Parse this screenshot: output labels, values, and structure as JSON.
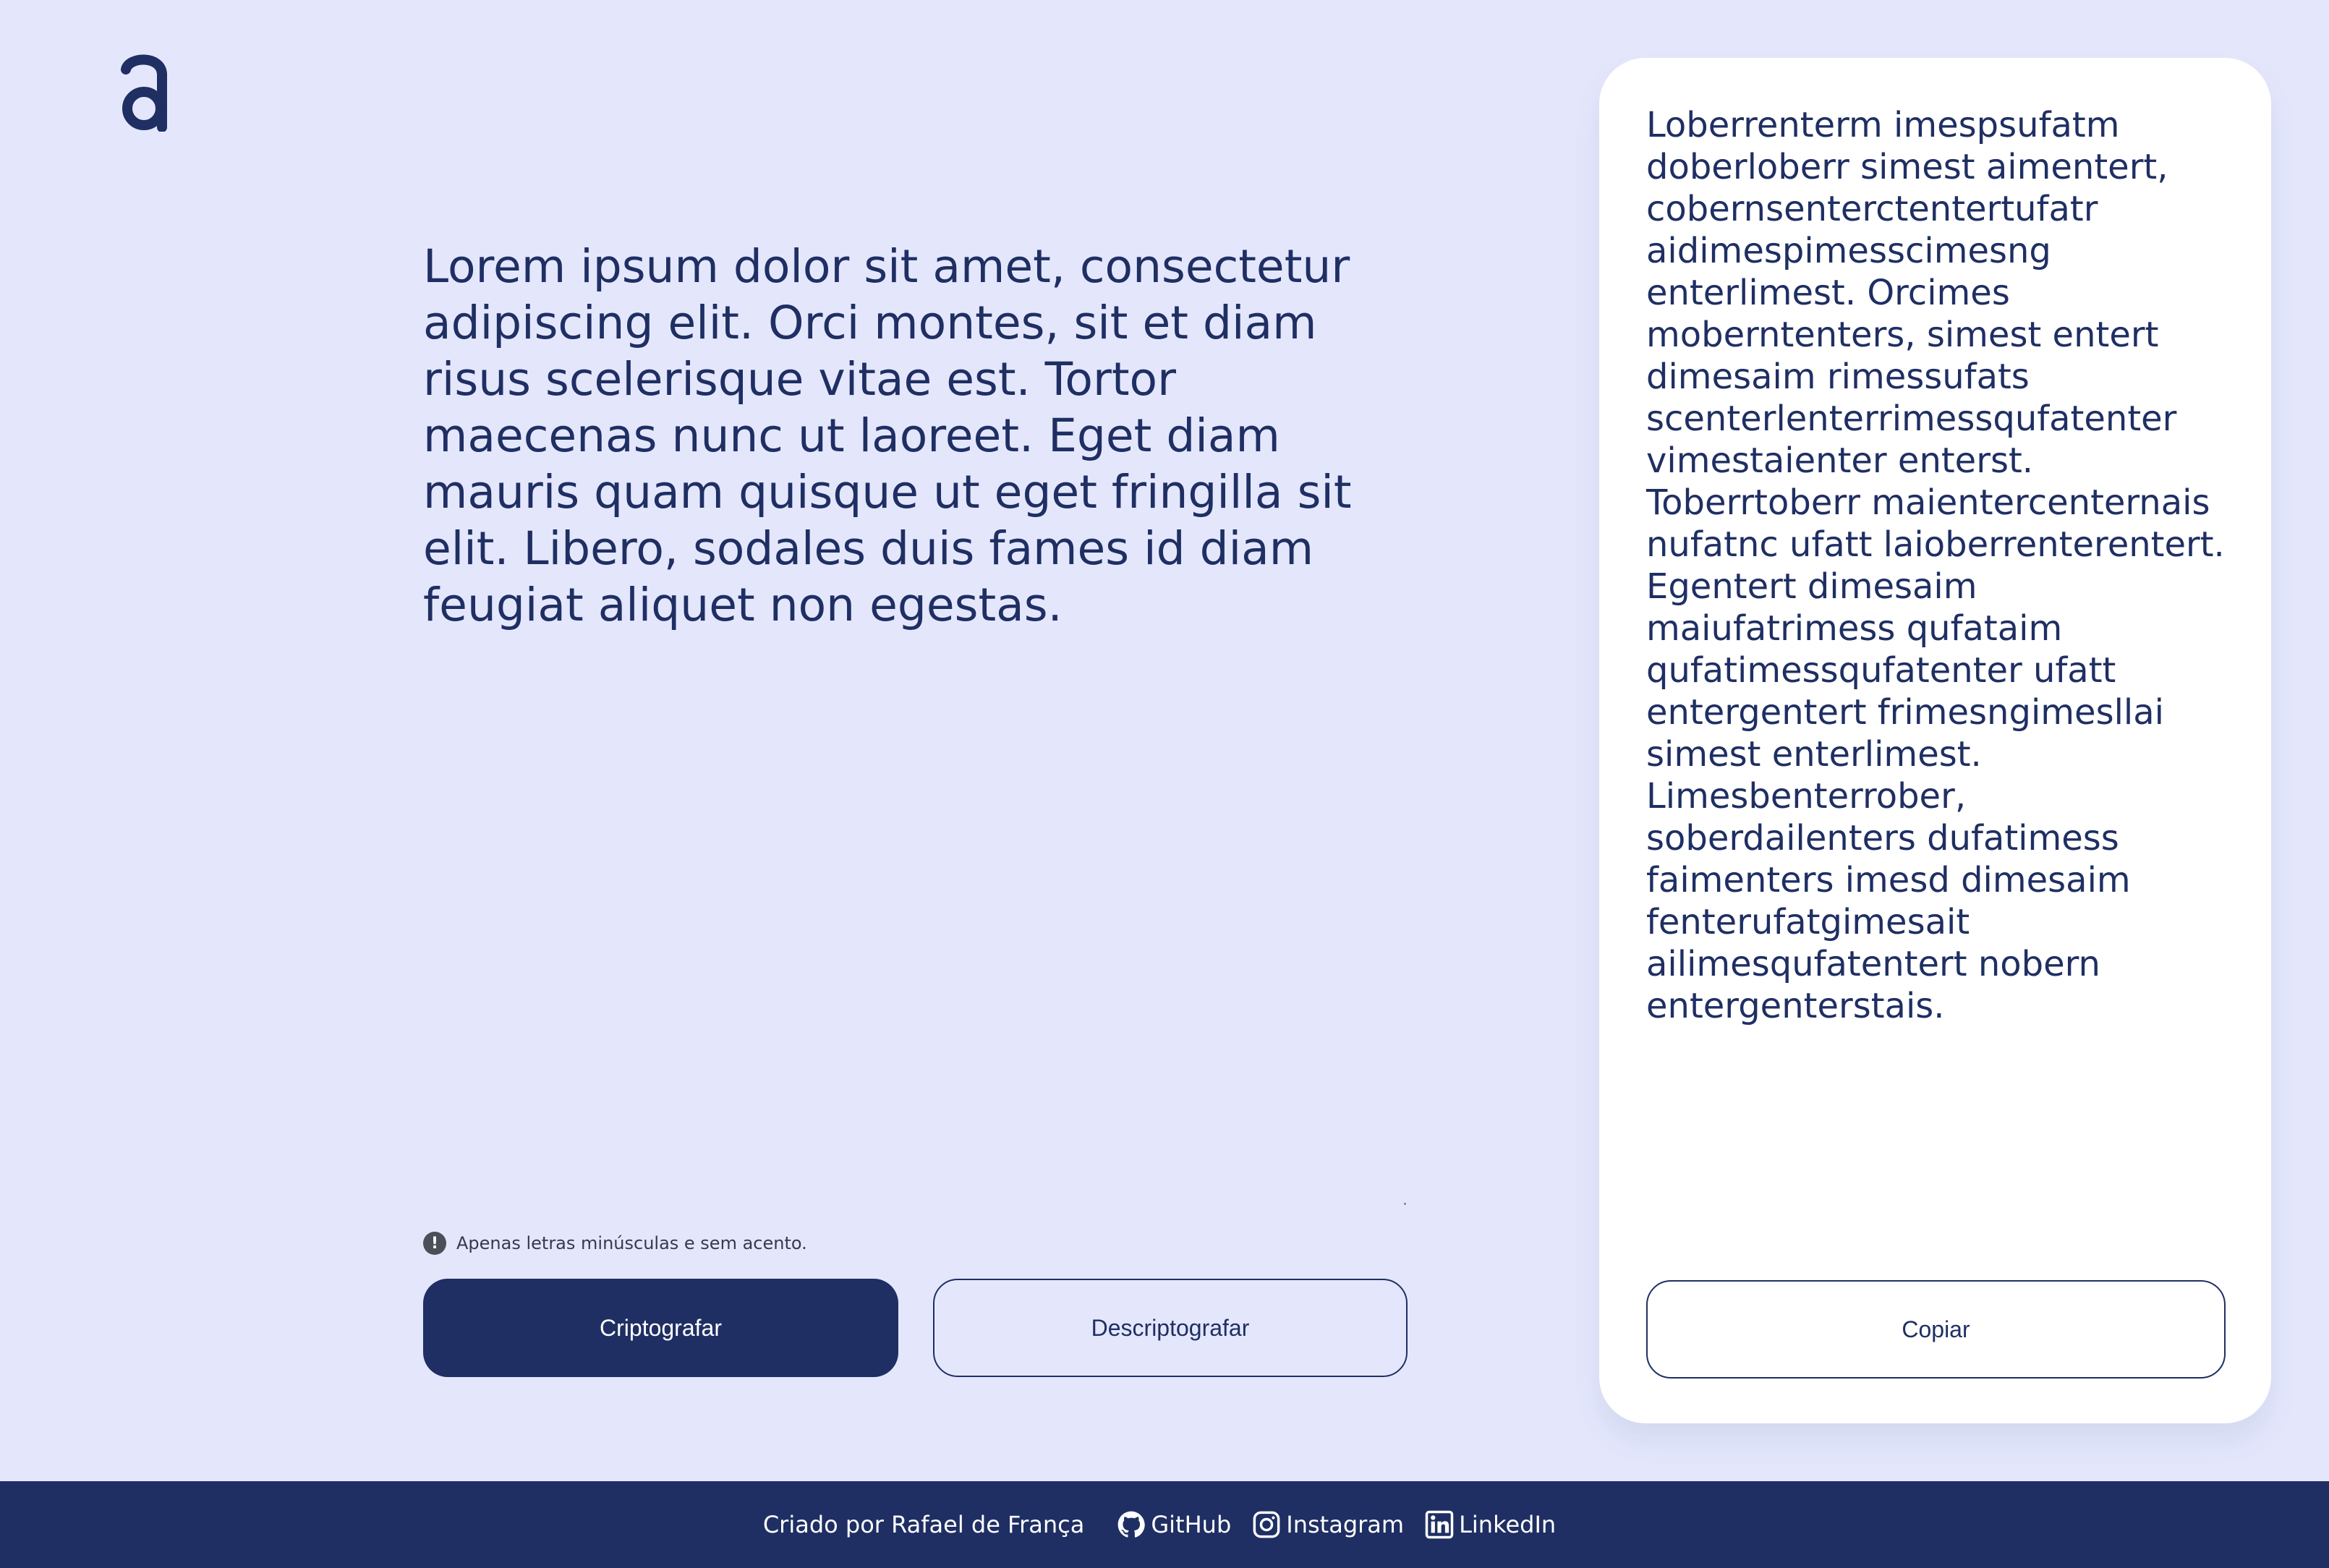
{
  "colors": {
    "background": "#e4e7fc",
    "primary": "#1f2f63",
    "panel": "#ffffff",
    "footer": "#1f2f63"
  },
  "logo": {
    "letter": "a",
    "icon": "logo-a-icon"
  },
  "input": {
    "text": "Lorem ipsum dolor sit amet, consectetur adipiscing elit. Orci montes, sit et diam risus scelerisque vitae est. Tortor maecenas nunc ut laoreet. Eget diam mauris quam quisque ut eget fringilla sit elit. Libero, sodales duis fames id diam feugiat aliquet non egestas."
  },
  "hint": {
    "icon": "exclamation-icon",
    "text": "Apenas letras minúsculas e sem acento."
  },
  "actions": {
    "encrypt_label": "Criptografar",
    "decrypt_label": "Descriptografar"
  },
  "output": {
    "text": "Loberrenterm imespsufatm doberloberr simest aimentert, cobernsenterctentertufatr aidimespimesscimesng enterlimest. Orcimes moberntenters, simest entert dimesaim rimessufats scenterlenterrimessqufatenter vimestaienter enterst. Toberrtoberr maientercenternais nufatnc ufatt laioberrenterentert. Egentert dimesaim maiufatrimess qufataim qufatimessqufatenter ufatt entergentert frimesngimesllai simest enterlimest. Limesbenterrober, soberdailenters dufatimess faimenters imesd dimesaim fenterufatgimesait ailimesqufatentert nobern entergenterstais.",
    "copy_label": "Copiar"
  },
  "footer": {
    "credit": "Criado por Rafael de França",
    "links": [
      {
        "label": "GitHub",
        "icon": "github-icon"
      },
      {
        "label": "Instagram",
        "icon": "instagram-icon"
      },
      {
        "label": "LinkedIn",
        "icon": "linkedin-icon"
      }
    ]
  }
}
